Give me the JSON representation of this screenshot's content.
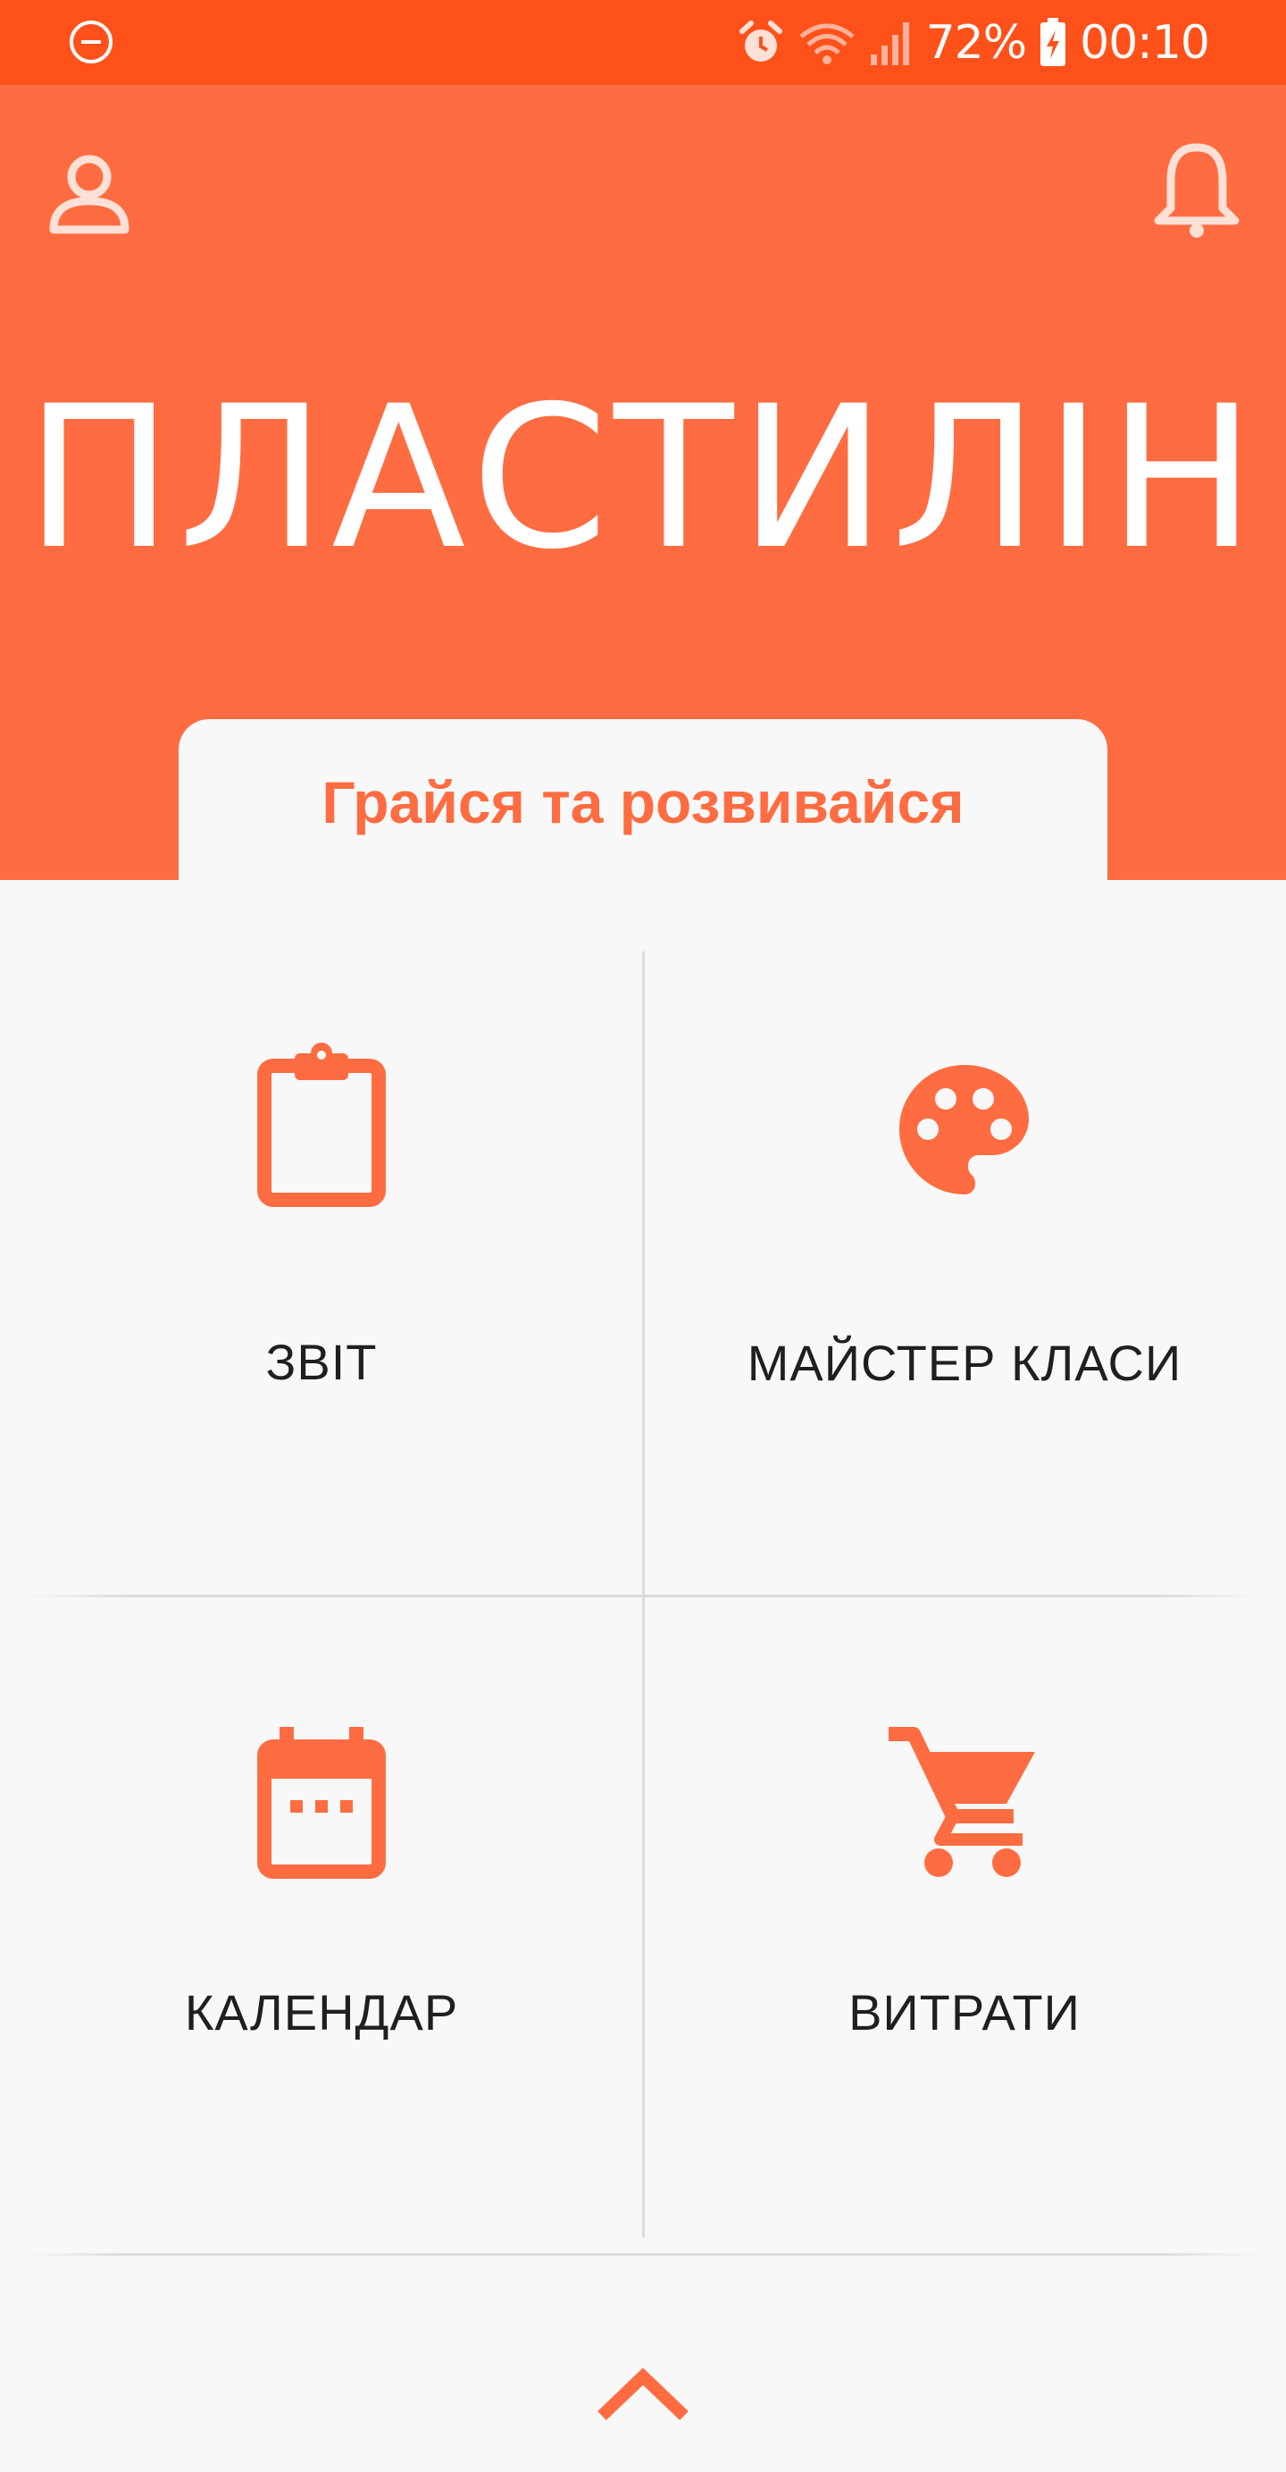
{
  "status_bar": {
    "battery": "72%",
    "time": "00:10",
    "icons": [
      "do-not-disturb-icon",
      "alarm-icon",
      "wifi-icon",
      "signal-icon",
      "battery-charging-icon"
    ]
  },
  "header": {
    "title": "ПЛАСТИЛІН",
    "tagline": "Грайся та розвивайся",
    "icons": [
      "profile-icon",
      "bell-icon"
    ]
  },
  "tiles": [
    {
      "label": "ЗВІТ",
      "icon": "clipboard-icon"
    },
    {
      "label": "МАЙСТЕР КЛАСИ",
      "icon": "palette-icon"
    },
    {
      "label": "КАЛЕНДАР",
      "icon": "calendar-icon"
    },
    {
      "label": "ВИТРАТИ",
      "icon": "cart-icon"
    }
  ],
  "footer": {
    "icon": "chevron-up-icon"
  },
  "colors": {
    "status_bar": "#ff5119",
    "header": "#ff6c41",
    "accent": "#ff6c41",
    "background": "#f8f8f8"
  }
}
